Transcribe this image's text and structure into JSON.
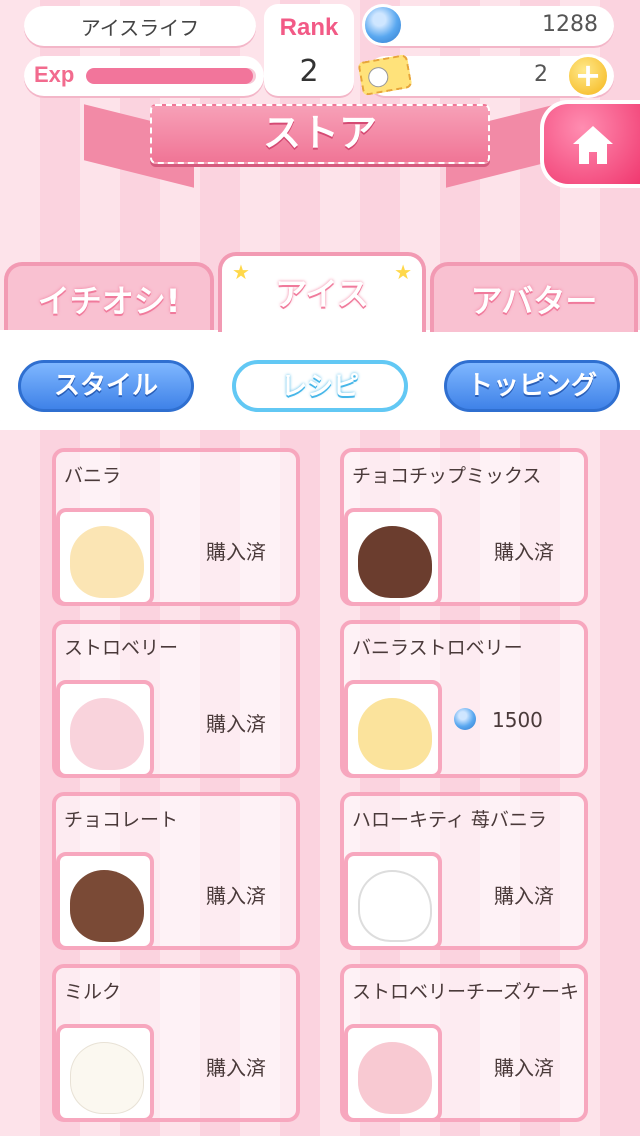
{
  "header": {
    "shop_name": "アイスライフ",
    "exp_label": "Exp",
    "exp_fraction": 0.98,
    "rank_label": "Rank",
    "rank_value": "2",
    "coins": "1288",
    "tickets": "2",
    "coin_icon": "blue-coin-icon",
    "ticket_icon": "hello-kitty-ticket-icon",
    "plus_icon": "plus-icon"
  },
  "title": "ストア",
  "home_icon": "home-icon",
  "tabs": [
    {
      "label": "イチオシ!"
    },
    {
      "label": "アイス",
      "selected": true
    },
    {
      "label": "アバター"
    }
  ],
  "subtabs": [
    {
      "label": "スタイル"
    },
    {
      "label": "レシピ",
      "selected": true
    },
    {
      "label": "トッピング"
    }
  ],
  "items": [
    {
      "name": "バニラ",
      "status": "購入済",
      "flavor_color": "#fbe5b4"
    },
    {
      "name": "チョコチップミックス",
      "status": "購入済",
      "flavor_color": "#6b3d2e"
    },
    {
      "name": "ストロベリー",
      "status": "購入済",
      "flavor_color": "#f9d3dc"
    },
    {
      "name": "バニラストロベリー",
      "price": "1500",
      "flavor_color": "#fbe39c"
    },
    {
      "name": "チョコレート",
      "status": "購入済",
      "flavor_color": "#7a4a36"
    },
    {
      "name": "ハローキティ 苺バニラ",
      "status": "購入済",
      "flavor_color": "#ffffff"
    },
    {
      "name": "ミルク",
      "status": "購入済",
      "flavor_color": "#fbf8f0"
    },
    {
      "name": "ストロベリーチーズケーキ",
      "status": "購入済",
      "flavor_color": "#f8c9d2"
    }
  ]
}
